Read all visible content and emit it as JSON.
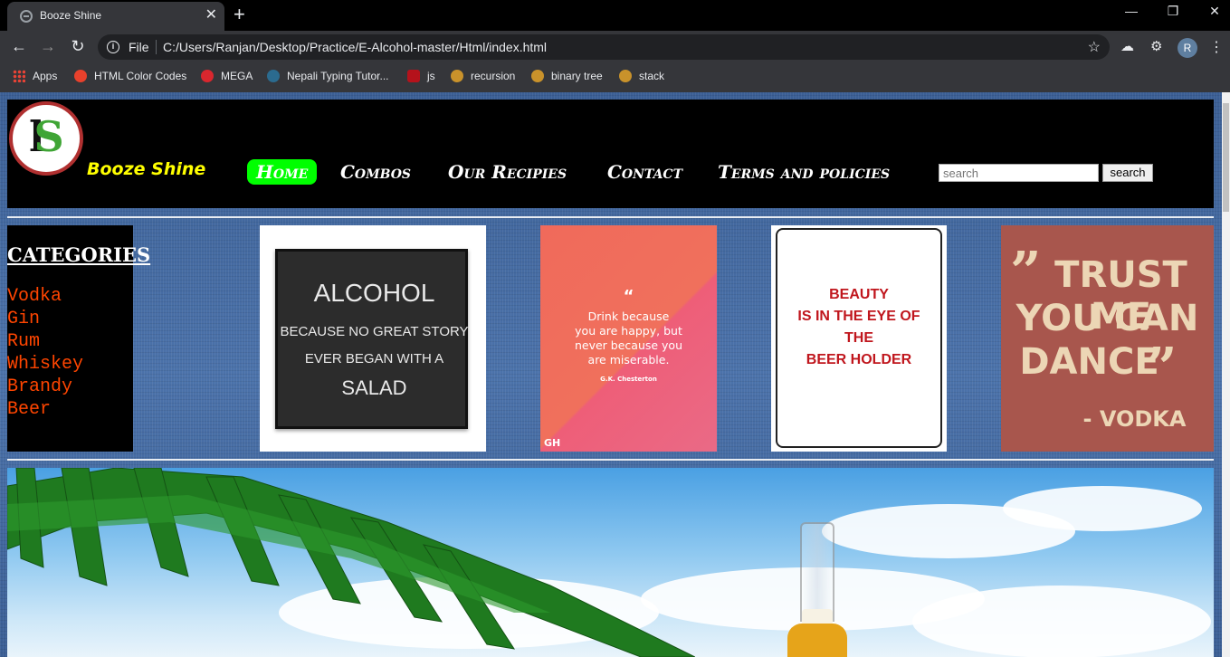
{
  "browser": {
    "tab_title": "Booze Shine",
    "new_tab": "+",
    "close_tab": "✕",
    "url_scheme": "File",
    "url": "C:/Users/Ranjan/Desktop/Practice/E-Alcohol-master/Html/index.html",
    "profile_initial": "R",
    "bookmarks": [
      "Apps",
      "HTML Color Codes",
      "MEGA",
      "Nepali Typing Tutor...",
      "js",
      "recursion",
      "binary tree",
      "stack"
    ]
  },
  "site": {
    "brand": "Booze Shine",
    "nav": [
      "Home",
      "Combos",
      "Our Recipies",
      "Contact",
      "Terms and policies"
    ],
    "search_placeholder": "search",
    "search_button": "search"
  },
  "sidebar": {
    "title": "CATEGORIES",
    "items": [
      "Vodka",
      "Gin",
      "Rum",
      "Whiskey",
      "Brandy",
      "Beer"
    ]
  },
  "posters": {
    "p1": {
      "line1": "ALCOHOL",
      "line2": "BECAUSE NO GREAT STORY",
      "line3": "EVER BEGAN WITH A",
      "line4": "SALAD"
    },
    "p2": {
      "mark": "“",
      "line1": "Drink because",
      "line2": "you are happy, but",
      "line3": "never because you",
      "line4": "are miserable.",
      "author": "G.K. Chesterton",
      "corner": "GH"
    },
    "p3": {
      "line1": "BEAUTY",
      "line2": "IS IN THE EYE OF",
      "line3": "THE",
      "line4": "BEER HOLDER"
    },
    "p4": {
      "line1": "TRUST ME",
      "line2": "YOU CAN",
      "line3": "DANCE",
      "quote_open": "”",
      "quote_close": "”",
      "author": "- VODKA"
    }
  },
  "colors": {
    "nav_active": "#00ff00",
    "brand": "#ffff00",
    "category_item": "#ff4500"
  }
}
